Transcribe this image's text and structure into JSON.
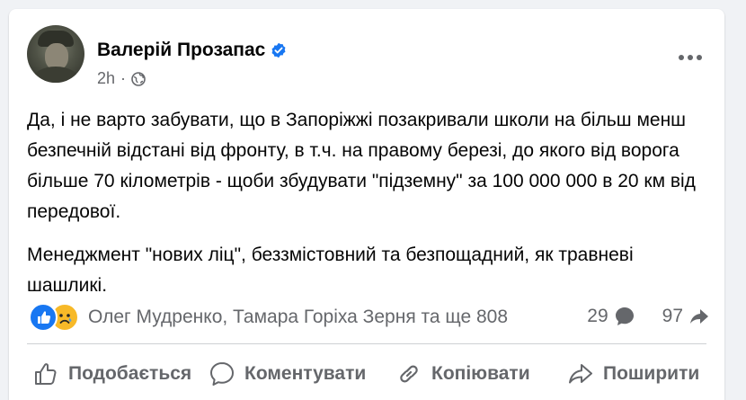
{
  "post": {
    "author_name": "Валерій Прозапас",
    "verified": true,
    "timestamp": "2h",
    "separator": "·",
    "audience_icon": "globe-icon",
    "paragraphs": [
      "Да, і не варто забувати, що в Запоріжжі позакривали школи на більш менш безпечній відстані від фронту, в т.ч. на правому березі, до якого від ворога більше 70 кілометрів - щоби збудувати \"підземну\" за 100 000 000 в 20 км від передової.",
      "Менеджмент \"нових ліц\", беззмістовний та безпощадний, як травневі шашликі."
    ]
  },
  "reactions": {
    "types": [
      "like",
      "sad"
    ],
    "summary": "Олег Мудренко, Тамара Горіха Зерня та ще 808",
    "comments_count": "29",
    "shares_count": "97"
  },
  "actions": {
    "like_label": "Подобається",
    "comment_label": "Коментувати",
    "copy_label": "Копіювати",
    "share_label": "Поширити"
  },
  "colors": {
    "background": "#f0f2f5",
    "card": "#ffffff",
    "text_primary": "#050505",
    "text_secondary": "#65676b",
    "verified_blue": "#1877f2",
    "like_blue": "#1877f2",
    "sad_yellow": "#f7b928",
    "divider": "#ced0d4"
  }
}
